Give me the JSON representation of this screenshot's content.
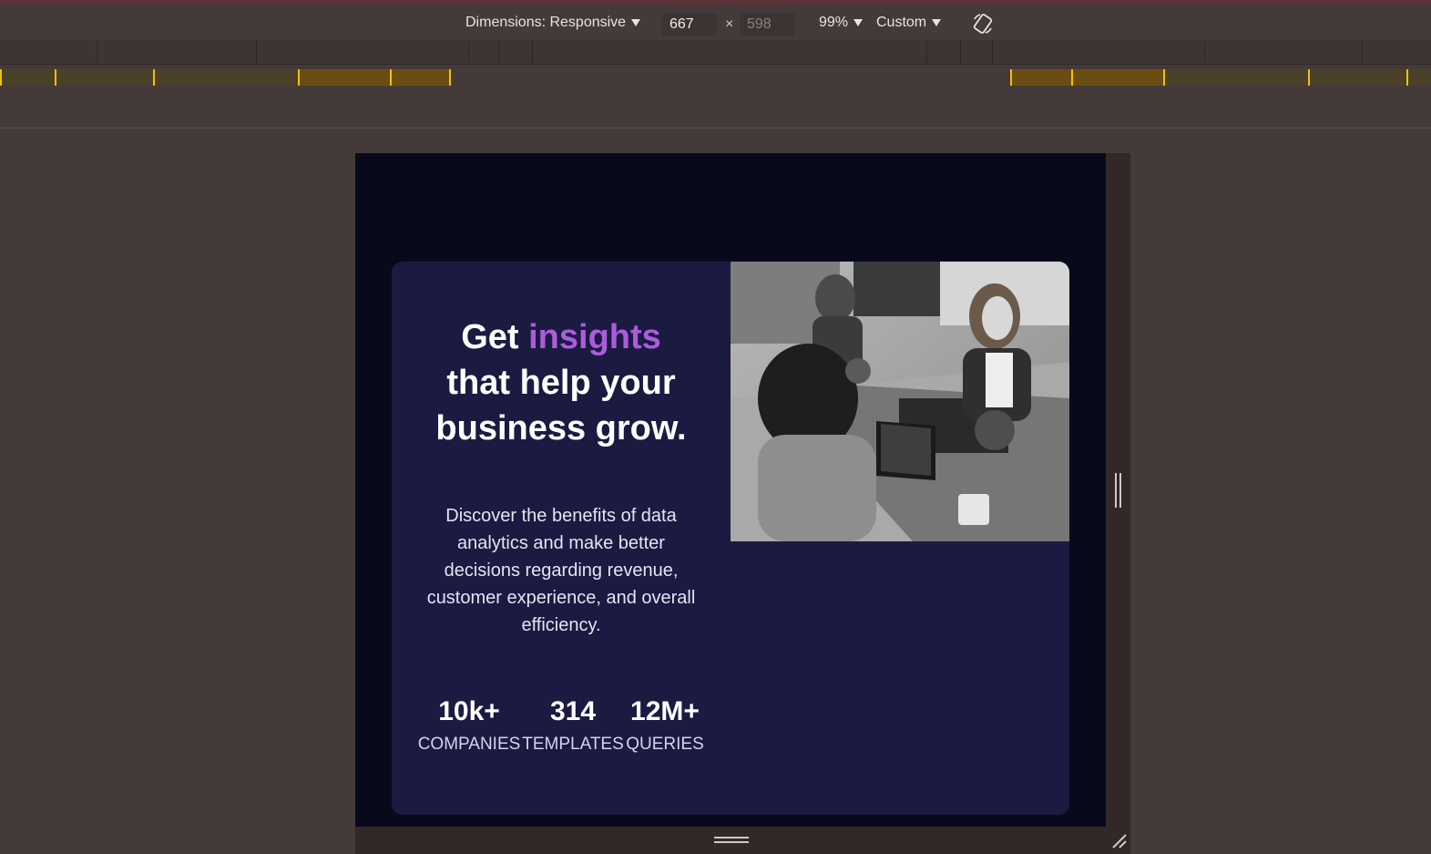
{
  "toolbar": {
    "dimensions_label": "Dimensions: Responsive",
    "width_value": "667",
    "height_value": "598",
    "times": "×",
    "zoom_label": "99%",
    "throttle_label": "Custom"
  },
  "colors": {
    "page_bg": "#080a1c",
    "card_bg": "#1b1a41",
    "accent": "#ab5cdb",
    "media_query_bar": "#f2c200"
  },
  "card": {
    "headline_word_1": "Get ",
    "headline_accent": "insights",
    "headline_line_2": "that help your",
    "headline_line_3": "business grow.",
    "description": "Discover the benefits of data analytics and make better decisions regarding revenue, customer experience, and overall efficiency.",
    "stats": [
      {
        "value": "10k+",
        "label": "COMPANIES"
      },
      {
        "value": "314",
        "label": "TEMPLATES"
      },
      {
        "value": "12M+",
        "label": "QUERIES"
      }
    ]
  }
}
